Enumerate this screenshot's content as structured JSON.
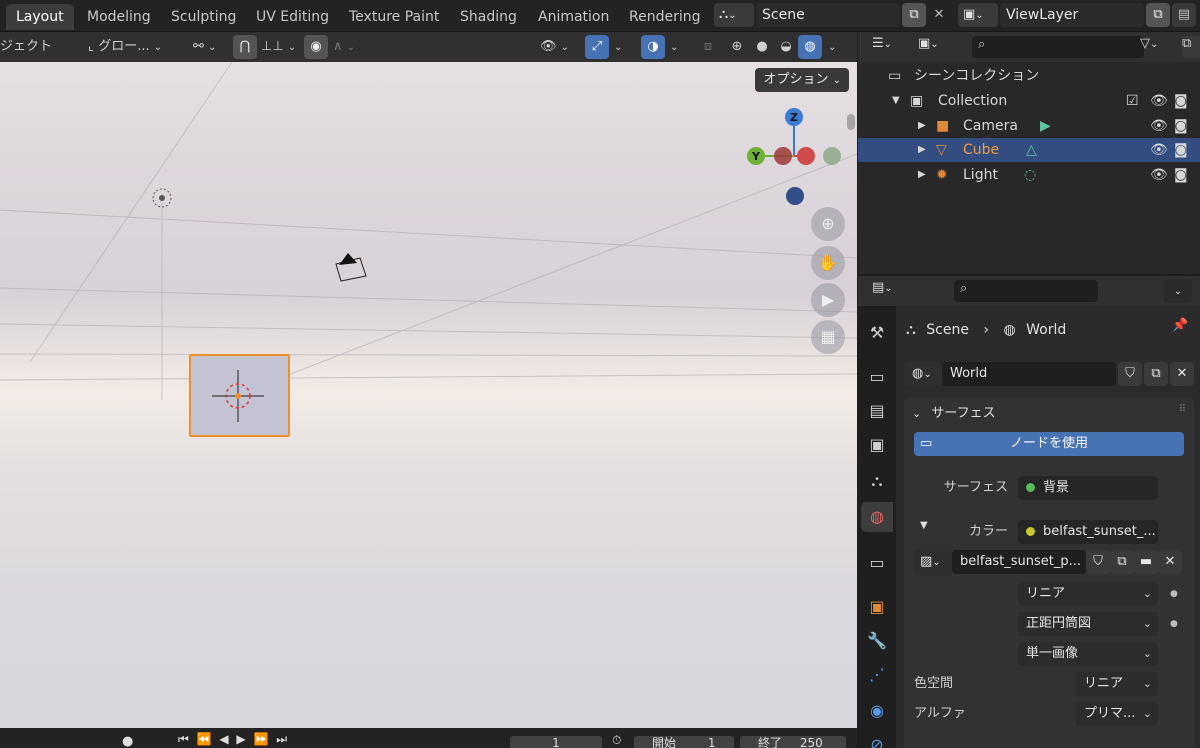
{
  "workspace_tabs": [
    {
      "label": "Layout",
      "active": true
    },
    {
      "label": "Modeling"
    },
    {
      "label": "Sculpting"
    },
    {
      "label": "UV Editing"
    },
    {
      "label": "Texture Paint"
    },
    {
      "label": "Shading"
    },
    {
      "label": "Animation"
    },
    {
      "label": "Rendering"
    }
  ],
  "scene_selector": {
    "value": "Scene"
  },
  "view_layer_selector": {
    "value": "ViewLayer"
  },
  "viewport_header": {
    "object_menu": "ジェクト",
    "transform_orientation": "グロー...",
    "options_label": "オプション"
  },
  "gizmo": {
    "z": "Z",
    "y": "Y"
  },
  "timeline": {
    "current_frame": "1",
    "start_label": "開始",
    "start_value": "1",
    "end_label": "終了",
    "end_value": "250"
  },
  "outliner": {
    "scene_collection": "シーンコレクション",
    "items": [
      {
        "label": "Collection"
      },
      {
        "label": "Camera"
      },
      {
        "label": "Cube",
        "selected": true
      },
      {
        "label": "Light"
      }
    ]
  },
  "properties": {
    "breadcrumb": {
      "scene": "Scene",
      "world": "World"
    },
    "world_name": "World",
    "surface_panel_title": "サーフェス",
    "use_nodes_label": "ノードを使用",
    "surface_label": "サーフェス",
    "surface_value": "背景",
    "color_label": "カラー",
    "color_value": "belfast_sunset_...",
    "image_name": "belfast_sunset_p...",
    "interpolation": "リニア",
    "projection": "正距円筒図",
    "extension": "単一画像",
    "color_space_label": "色空間",
    "color_space_value": "リニア",
    "alpha_label": "アルファ",
    "alpha_value": "プリマ..."
  },
  "colors": {
    "accent_blue": "#4772b3",
    "selection_orange": "#ef8f28",
    "outliner_selected": "#334d80"
  }
}
